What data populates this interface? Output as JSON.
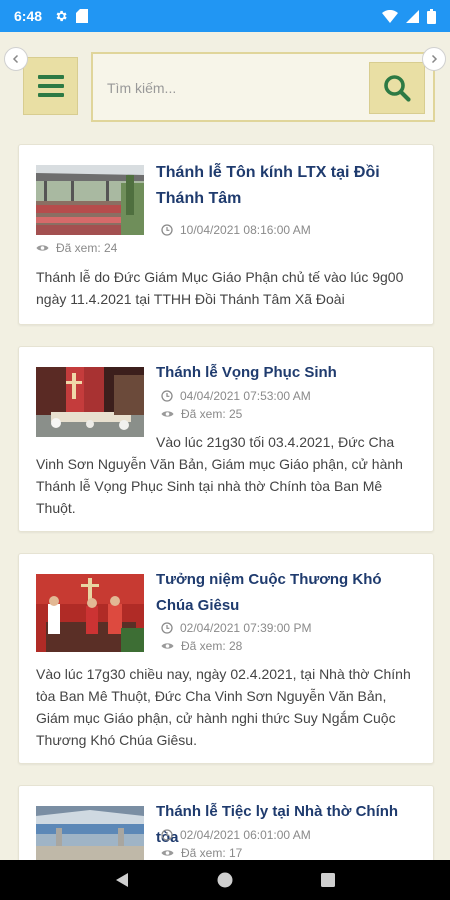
{
  "status_bar": {
    "time": "6:48",
    "icons": [
      "gear-icon",
      "sd-card-icon",
      "wifi-icon",
      "signal-icon",
      "battery-icon"
    ]
  },
  "header": {
    "menu_icon": "hamburger-icon",
    "search": {
      "placeholder": "Tìm kiếm...",
      "value": "",
      "icon": "search-icon"
    }
  },
  "colors": {
    "status_bar": "#2196f3",
    "background": "#f2f0e2",
    "accent": "#e9dfa4",
    "icon_green": "#2d7a44",
    "title": "#1f3b6e"
  },
  "articles": [
    {
      "title": "Thánh lễ Tôn kính LTX tại Đồi Thánh Tâm",
      "date": "10/04/2021 08:16:00 AM",
      "views": "Đã xem: 24",
      "summary": "Thánh lễ do Đức Giám Mục Giáo Phận chủ tế vào lúc 9g00 ngày 11.4.2021 tại TTHH Đồi Thánh Tâm Xã Đoài"
    },
    {
      "title": "Thánh lễ Vọng Phục Sinh",
      "date": "04/04/2021 07:53:00 AM",
      "views": "Đã xem: 25",
      "summary": "Vào lúc 21g30 tối 03.4.2021, Đức Cha Vinh Sơn Nguyễn Văn Bản, Giám mục Giáo phận, cử hành Thánh lễ Vọng Phục Sinh tại nhà thờ Chính tòa Ban Mê Thuột."
    },
    {
      "title": "Tưởng niệm Cuộc Thương Khó Chúa Giêsu",
      "date": "02/04/2021 07:39:00 PM",
      "views": "Đã xem: 28",
      "summary": "Vào lúc 17g30 chiều nay, ngày 02.4.2021, tại Nhà thờ Chính tòa Ban Mê Thuột, Đức Cha Vinh Sơn Nguyễn Văn Bản, Giám mục Giáo phận, cử hành nghi thức Suy Ngắm Cuộc Thương Khó Chúa Giêsu."
    },
    {
      "title": "Thánh lễ Tiệc ly tại Nhà thờ Chính tòa",
      "date": "02/04/2021 06:01:00 AM",
      "views": "Đã xem: 17"
    }
  ],
  "nav_bar": {
    "icons": [
      "back-icon",
      "home-icon",
      "recents-icon"
    ]
  }
}
